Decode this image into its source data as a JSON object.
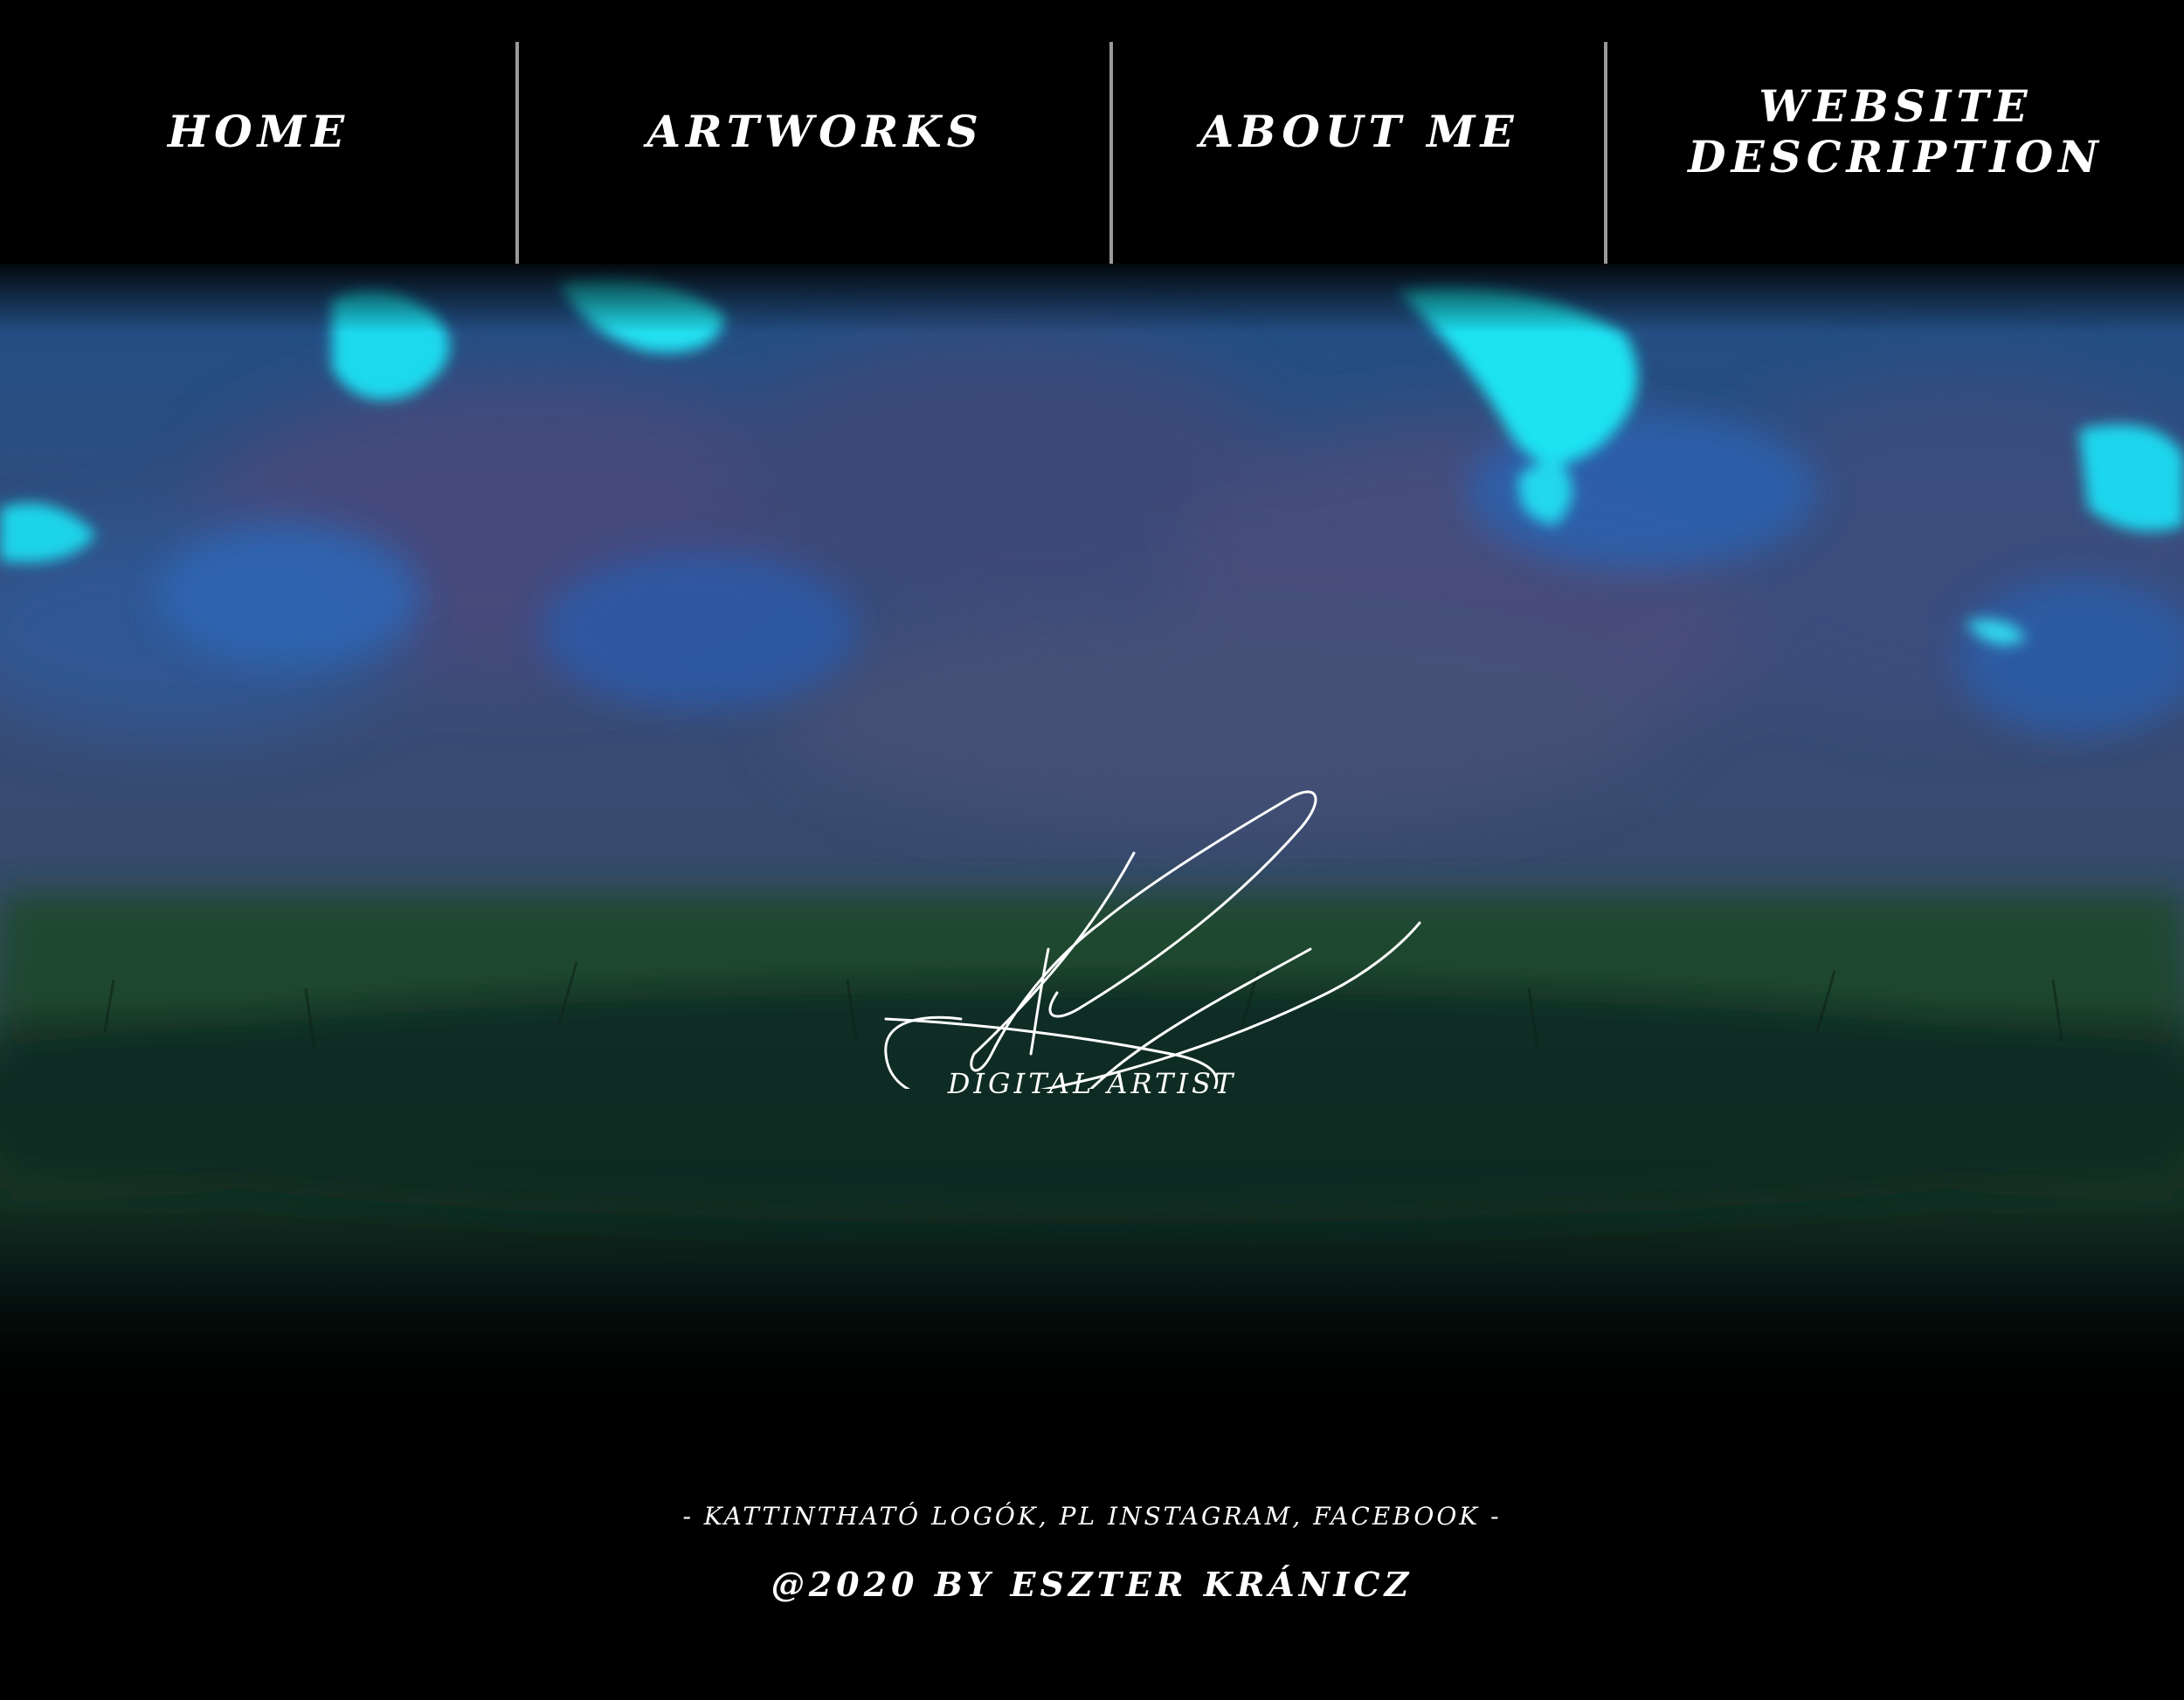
{
  "nav": {
    "items": [
      {
        "label": "Home"
      },
      {
        "label": "Artworks"
      },
      {
        "label": "About me"
      },
      {
        "label_line1": "Website",
        "label_line2": "Description"
      }
    ]
  },
  "hero": {
    "tagline": "Digital Artist",
    "signature_icon": "signature-logo",
    "colors": {
      "sky_glow": "#17e3f2",
      "sky_blue": "#2a5a9a",
      "sky_purple": "#4a4f7a",
      "grass": "#1a3f24",
      "ground_dark": "#0a1c1a"
    }
  },
  "footer": {
    "note": "- kattintható logók, pl instagram, facebook -",
    "copyright": "@2020 by Eszter Kránicz"
  }
}
